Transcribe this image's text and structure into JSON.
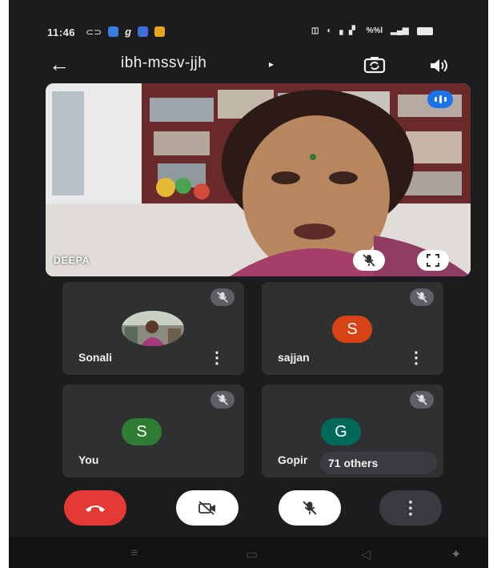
{
  "status": {
    "time": "11:46",
    "network": "%%l"
  },
  "meeting": {
    "title": "ibh-mssv-jjh",
    "caret": "▸"
  },
  "main_video": {
    "name": "DEEPA",
    "icons": [
      "mic-off-icon",
      "fullscreen-icon",
      "speaking-indicator-icon"
    ]
  },
  "tiles": [
    {
      "name": "Sonali",
      "avatar_type": "photo",
      "menu": "⋮"
    },
    {
      "name": "sajjan",
      "avatar_letter": "S",
      "avatar_color": "#d84315",
      "menu": "⋮"
    },
    {
      "name": "You",
      "avatar_letter": "S",
      "avatar_color": "#2e7d32"
    },
    {
      "name": "Gopir",
      "avatar_letter": "G",
      "avatar_color": "#00695c"
    }
  ],
  "others": {
    "label": "71 others"
  },
  "controls": {
    "end_call_color": "#e53935",
    "more": "⋮"
  },
  "colors": {
    "background": "#1b1c1e",
    "tile": "#2f3032",
    "accent_blue": "#1a73e8"
  }
}
